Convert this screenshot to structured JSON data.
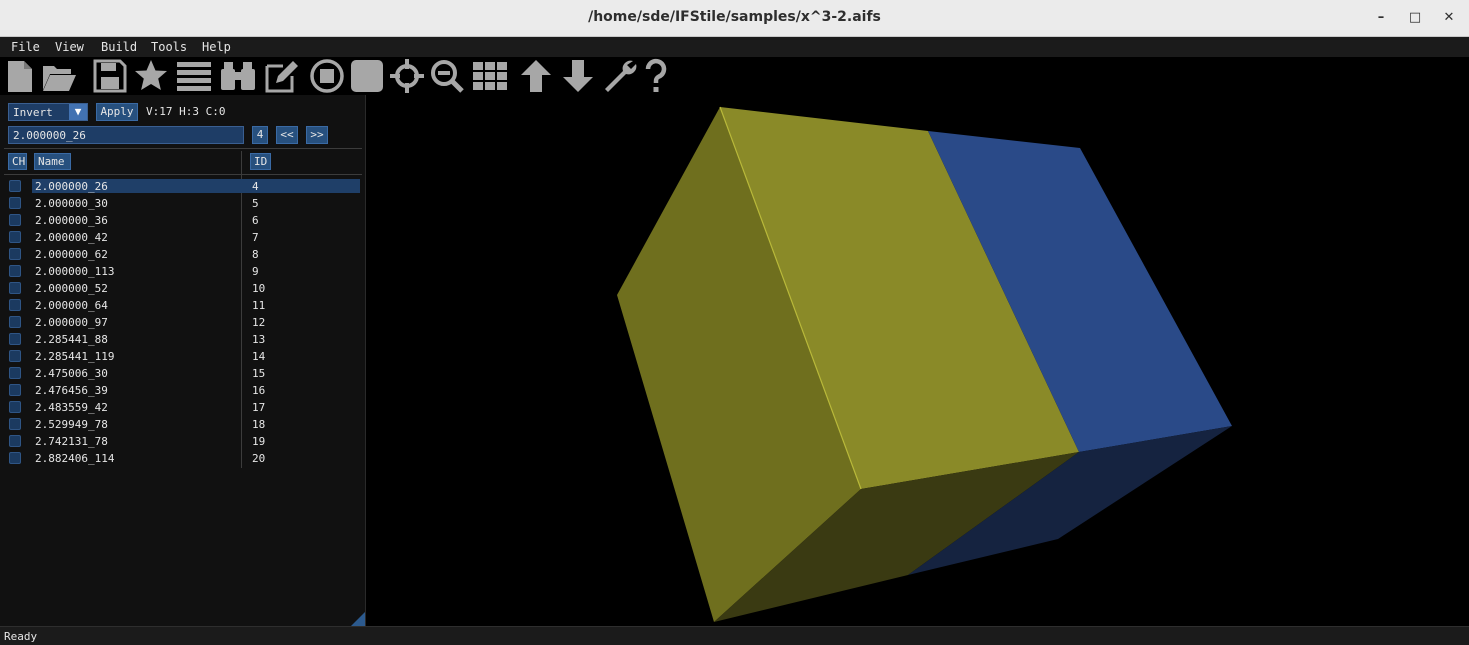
{
  "window": {
    "title": "/home/sde/IFStile/samples/x^3-2.aifs",
    "minimize": "–",
    "maximize": "□",
    "close": "✕"
  },
  "menu": {
    "items": [
      "File",
      "View",
      "Build",
      "Tools",
      "Help"
    ]
  },
  "toolbar": {
    "icons": [
      "new-file-icon",
      "open-folder-icon",
      "save-icon",
      "star-icon",
      "list-icon",
      "binoculars-icon",
      "edit-icon",
      "stop-circle-icon",
      "stop-square-icon",
      "crosshair-icon",
      "zoom-out-icon",
      "grid-icon",
      "arrow-up-icon",
      "arrow-down-icon",
      "wrench-icon",
      "help-icon"
    ],
    "color": "#a7a7a7"
  },
  "panel": {
    "mode_dropdown": {
      "value": "Invert",
      "arrow": "▼"
    },
    "apply_label": "Apply",
    "stats": "V:17 H:3 C:0",
    "search_value": "2.000000_26",
    "current_id": "4",
    "prev_label": "<<",
    "next_label": ">>",
    "columns": {
      "ch": "CH",
      "name": "Name",
      "id": "ID"
    },
    "rows": [
      {
        "name": "2.000000_26",
        "id": "4",
        "selected": true
      },
      {
        "name": "2.000000_30",
        "id": "5"
      },
      {
        "name": "2.000000_36",
        "id": "6"
      },
      {
        "name": "2.000000_42",
        "id": "7"
      },
      {
        "name": "2.000000_62",
        "id": "8"
      },
      {
        "name": "2.000000_113",
        "id": "9"
      },
      {
        "name": "2.000000_52",
        "id": "10"
      },
      {
        "name": "2.000000_64",
        "id": "11"
      },
      {
        "name": "2.000000_97",
        "id": "12"
      },
      {
        "name": "2.285441_88",
        "id": "13"
      },
      {
        "name": "2.285441_119",
        "id": "14"
      },
      {
        "name": "2.475006_30",
        "id": "15"
      },
      {
        "name": "2.476456_39",
        "id": "16"
      },
      {
        "name": "2.483559_42",
        "id": "17"
      },
      {
        "name": "2.529949_78",
        "id": "18"
      },
      {
        "name": "2.742131_78",
        "id": "19"
      },
      {
        "name": "2.882406_114",
        "id": "20"
      }
    ]
  },
  "viewport": {
    "colors": {
      "yellow_top": "#8a8a28",
      "yellow_left": "#6f6f1e",
      "yellow_bottom": "#3a3a12",
      "blue_side": "#2a4a88",
      "blue_bottom": "#152340"
    }
  },
  "status": {
    "text": "Ready"
  }
}
